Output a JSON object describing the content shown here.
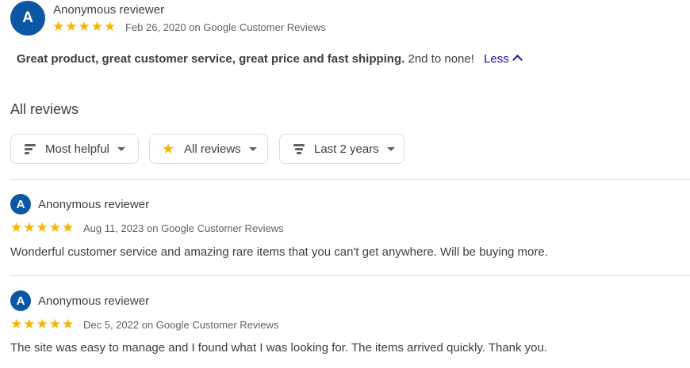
{
  "top_review": {
    "avatar_letter": "A",
    "name": "Anonymous reviewer",
    "stars": "★★★★★",
    "meta": "Feb 26, 2020 on Google Customer Reviews",
    "text_bold": "Great product, great customer service, great price and fast shipping.",
    "text_rest": "2nd to none!",
    "less_label": "Less"
  },
  "section_title": "All reviews",
  "filters": {
    "sort_label": "Most helpful",
    "rating_label": "All reviews",
    "time_label": "Last 2 years"
  },
  "reviews": [
    {
      "avatar_letter": "A",
      "name": "Anonymous reviewer",
      "stars": "★★★★★",
      "meta": "Aug 11, 2023 on Google Customer Reviews",
      "text": "Wonderful customer service and amazing rare items that you can't get anywhere. Will be buying more."
    },
    {
      "avatar_letter": "A",
      "name": "Anonymous reviewer",
      "stars": "★★★★★",
      "meta": "Dec 5, 2022 on Google Customer Reviews",
      "text": "The site was easy to manage and I found what I was looking for. The items arrived quickly. Thank you."
    }
  ],
  "colors": {
    "avatar": "#0b57a4",
    "star": "#f4b400",
    "link": "#1a0dab",
    "divider": "#dadce0"
  }
}
